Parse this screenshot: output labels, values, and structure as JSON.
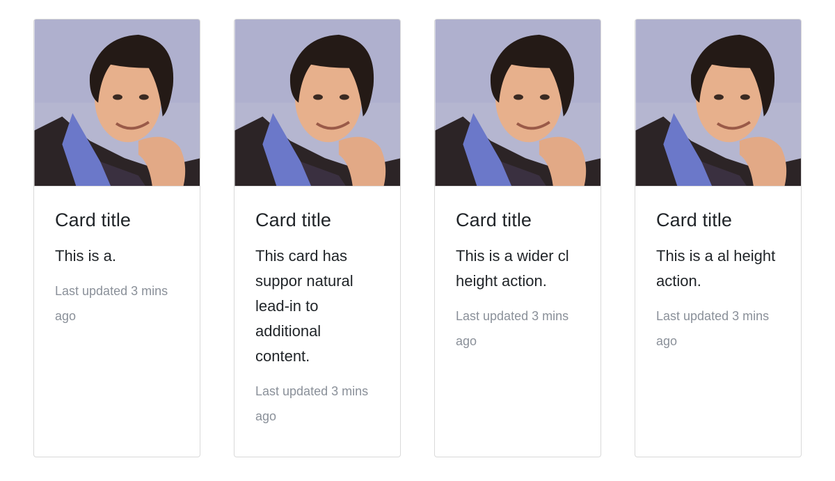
{
  "cards": [
    {
      "image_alt": "Portrait photo",
      "title": "Card title",
      "text": "This is a.",
      "meta": "Last updated 3 mins ago"
    },
    {
      "image_alt": "Portrait photo",
      "title": "Card title",
      "text": "This card has suppor natural lead-in to additional content.",
      "meta": "Last updated 3 mins ago"
    },
    {
      "image_alt": "Portrait photo",
      "title": "Card title",
      "text": "This is a wider cl height action.",
      "meta": "Last updated 3 mins ago"
    },
    {
      "image_alt": "Portrait photo",
      "title": "Card title",
      "text": "This is a al height action.",
      "meta": "Last updated 3 mins ago"
    }
  ],
  "colors": {
    "title": "#212529",
    "muted": "#8a9099",
    "border": "#d9d9d9",
    "photo_background": "#b7b8d2"
  }
}
